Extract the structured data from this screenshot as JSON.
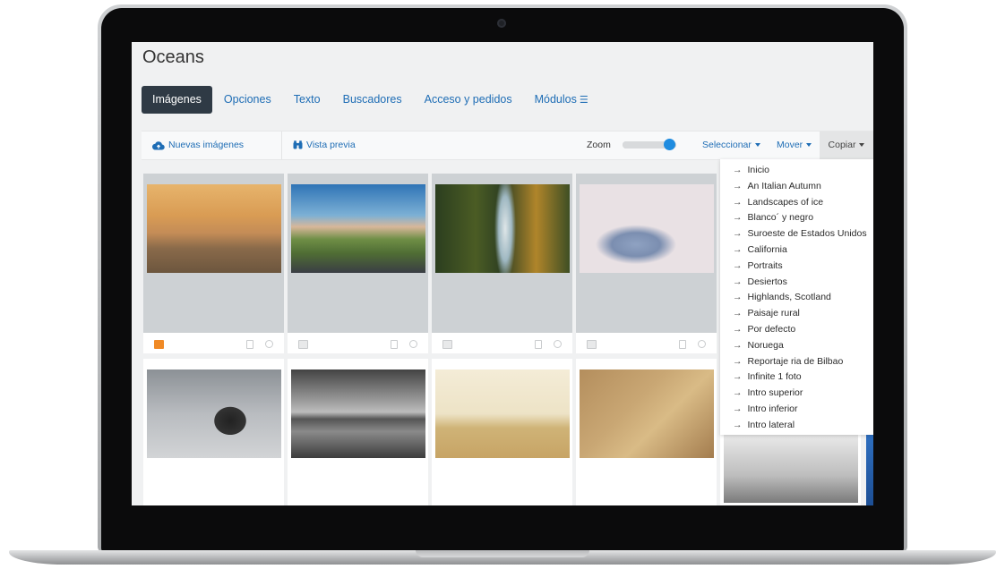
{
  "page": {
    "title": "Oceans"
  },
  "tabs": [
    {
      "label": "Imágenes",
      "active": true
    },
    {
      "label": "Opciones"
    },
    {
      "label": "Texto"
    },
    {
      "label": "Buscadores"
    },
    {
      "label": "Acceso y pedidos"
    },
    {
      "label": "Módulos",
      "icon": "hamburger-icon"
    }
  ],
  "toolbar": {
    "new_images": {
      "label": "Nuevas imágenes",
      "icon": "cloud-upload-icon"
    },
    "preview": {
      "label": "Vista previa",
      "icon": "binoculars-icon"
    },
    "zoom": {
      "label": "Zoom",
      "value": 0.85
    },
    "select_label": "Seleccionar",
    "move_label": "Mover",
    "copy_label": "Copiar"
  },
  "copy_menu": {
    "items": [
      "Inicio",
      "An Italian Autumn",
      "Landscapes of ice",
      "Blanco´ y negro",
      "Suroeste de Estados Unidos",
      "California",
      "Portraits",
      "Desiertos",
      "Highlands, Scotland",
      "Paisaje rural",
      "Por defecto",
      "Noruega",
      "Reportaje ria de Bilbao",
      "Infinite 1 foto",
      "Intro superior",
      "Intro inferior",
      "Intro lateral"
    ]
  },
  "colors": {
    "accent": "#1e6db5",
    "active_tab": "#2f3a45",
    "slider_knob": "#1f8ce0",
    "selected_icon": "#f08a26"
  }
}
